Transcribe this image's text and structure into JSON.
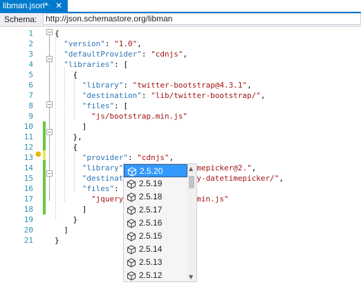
{
  "tab": {
    "title": "libman.json*",
    "pin_icon": "pin-icon",
    "close_icon": "close-icon"
  },
  "schema": {
    "label": "Schema:",
    "value": "http://json.schemastore.org/libman"
  },
  "lines": [
    {
      "n": "1",
      "tokens": [
        [
          "p",
          "{"
        ]
      ]
    },
    {
      "n": "2",
      "tokens": [
        [
          "p",
          "  "
        ],
        [
          "k",
          "\"version\""
        ],
        [
          "p",
          ": "
        ],
        [
          "s",
          "\"1.0\""
        ],
        [
          "p",
          ","
        ]
      ]
    },
    {
      "n": "3",
      "tokens": [
        [
          "p",
          "  "
        ],
        [
          "k",
          "\"defaultProvider\""
        ],
        [
          "p",
          ": "
        ],
        [
          "s",
          "\"cdnjs\""
        ],
        [
          "p",
          ","
        ]
      ]
    },
    {
      "n": "4",
      "tokens": [
        [
          "p",
          "  "
        ],
        [
          "k",
          "\"libraries\""
        ],
        [
          "p",
          ": ["
        ]
      ]
    },
    {
      "n": "5",
      "tokens": [
        [
          "p",
          "    {"
        ]
      ]
    },
    {
      "n": "6",
      "tokens": [
        [
          "p",
          "      "
        ],
        [
          "k",
          "\"library\""
        ],
        [
          "p",
          ": "
        ],
        [
          "s",
          "\"twitter-bootstrap@4.3.1\""
        ],
        [
          "p",
          ","
        ]
      ]
    },
    {
      "n": "7",
      "tokens": [
        [
          "p",
          "      "
        ],
        [
          "k",
          "\"destination\""
        ],
        [
          "p",
          ": "
        ],
        [
          "s",
          "\"lib/twitter-bootstrap/\""
        ],
        [
          "p",
          ","
        ]
      ]
    },
    {
      "n": "8",
      "tokens": [
        [
          "p",
          "      "
        ],
        [
          "k",
          "\"files\""
        ],
        [
          "p",
          ": ["
        ]
      ]
    },
    {
      "n": "9",
      "tokens": [
        [
          "p",
          "        "
        ],
        [
          "s",
          "\"js/bootstrap.min.js\""
        ]
      ]
    },
    {
      "n": "10",
      "tokens": [
        [
          "p",
          "      ]"
        ]
      ]
    },
    {
      "n": "11",
      "tokens": [
        [
          "p",
          "    },"
        ]
      ]
    },
    {
      "n": "12",
      "tokens": [
        [
          "p",
          "    {"
        ]
      ]
    },
    {
      "n": "13",
      "tokens": [
        [
          "p",
          "      "
        ],
        [
          "k",
          "\"provider\""
        ],
        [
          "p",
          ": "
        ],
        [
          "s",
          "\"cdnjs\""
        ],
        [
          "p",
          ","
        ]
      ]
    },
    {
      "n": "14",
      "tokens": [
        [
          "p",
          "      "
        ],
        [
          "k",
          "\"library\""
        ],
        [
          "p",
          ": "
        ],
        [
          "s",
          "\"jquery-datetimepicker@2.\""
        ],
        [
          "p",
          ","
        ]
      ]
    },
    {
      "n": "15",
      "tokens": [
        [
          "p",
          "      "
        ],
        [
          "k",
          "\"destination\""
        ],
        [
          "p",
          ": "
        ],
        [
          "s",
          "\"lib/jquery-datetimepicker/\""
        ],
        [
          "p",
          ","
        ]
      ]
    },
    {
      "n": "16",
      "tokens": [
        [
          "p",
          "      "
        ],
        [
          "k",
          "\"files\""
        ],
        [
          "p",
          ": ["
        ]
      ]
    },
    {
      "n": "17",
      "tokens": [
        [
          "p",
          "        "
        ],
        [
          "s",
          "\"jquery.datetimepicker.min.js\""
        ]
      ]
    },
    {
      "n": "18",
      "tokens": [
        [
          "p",
          "      ]"
        ]
      ]
    },
    {
      "n": "19",
      "tokens": [
        [
          "p",
          "    }"
        ]
      ]
    },
    {
      "n": "20",
      "tokens": [
        [
          "p",
          "  ]"
        ]
      ]
    },
    {
      "n": "21",
      "tokens": [
        [
          "p",
          "}"
        ]
      ]
    }
  ],
  "completion": {
    "icon": "package-cube-icon",
    "items": [
      "2.5.20",
      "2.5.19",
      "2.5.18",
      "2.5.17",
      "2.5.16",
      "2.5.15",
      "2.5.14",
      "2.5.13",
      "2.5.12"
    ],
    "selected_index": 0
  },
  "colors": {
    "accent": "#007acc",
    "line_numbers": "#2b91af",
    "keys": "#2e75b6",
    "strings": "#a31515",
    "selection": "#3399ff"
  }
}
